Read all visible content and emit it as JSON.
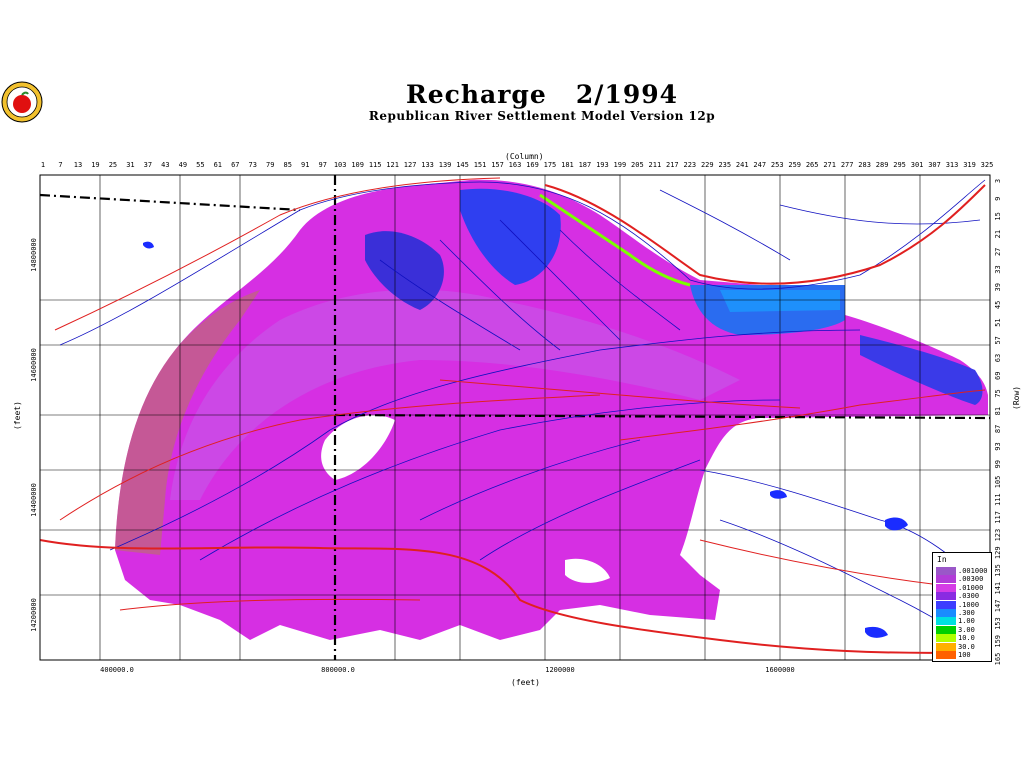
{
  "header": {
    "title": "Recharge   2/1994",
    "subtitle": "Republican River Settlement Model Version 12p"
  },
  "axes": {
    "column_label": "(Column)",
    "row_label": "(Row)",
    "y_label": "(feet)",
    "x_label": "(feet)",
    "column_ticks": [
      "1",
      "7",
      "13",
      "19",
      "25",
      "31",
      "37",
      "43",
      "49",
      "55",
      "61",
      "67",
      "73",
      "79",
      "85",
      "91",
      "97",
      "103",
      "109",
      "115",
      "121",
      "127",
      "133",
      "139",
      "145",
      "151",
      "157",
      "163",
      "169",
      "175",
      "181",
      "187",
      "193",
      "199",
      "205",
      "211",
      "217",
      "223",
      "229",
      "235",
      "241",
      "247",
      "253",
      "259",
      "265",
      "271",
      "277",
      "283",
      "289",
      "295",
      "301",
      "307",
      "313",
      "319",
      "325"
    ],
    "row_ticks": [
      "3",
      "9",
      "15",
      "21",
      "27",
      "33",
      "39",
      "45",
      "51",
      "57",
      "63",
      "69",
      "75",
      "81",
      "87",
      "93",
      "99",
      "105",
      "111",
      "117",
      "123",
      "129",
      "135",
      "141",
      "147",
      "153",
      "159",
      "165"
    ],
    "y_ticks": [
      "14800000",
      "14600000",
      "14400000",
      "14200000"
    ],
    "x_ticks": [
      "400000.0",
      "800000.0",
      "1200000",
      "1600000"
    ]
  },
  "legend": {
    "title": "In",
    "entries": [
      {
        "label": ".001000",
        "color": "#9a57c8"
      },
      {
        "label": ".00300",
        "color": "#b23cd8"
      },
      {
        "label": ".01000",
        "color": "#d53ce6"
      },
      {
        "label": ".0300",
        "color": "#8a2be2"
      },
      {
        "label": ".1000",
        "color": "#3d3dff"
      },
      {
        "label": ".300",
        "color": "#1a8cff"
      },
      {
        "label": "1.00",
        "color": "#00e0e0"
      },
      {
        "label": "3.00",
        "color": "#00d000"
      },
      {
        "label": "10.0",
        "color": "#b0ff00"
      },
      {
        "label": "30.0",
        "color": "#ffb000"
      },
      {
        "label": "100",
        "color": "#ff6000"
      }
    ]
  },
  "colors": {
    "recharge_base": "#d62fe3",
    "recharge_light": "#c55ae8",
    "recharge_high": "#2f3ff0",
    "road": "#e02020",
    "river": "#1010c0",
    "border": "#000000"
  }
}
